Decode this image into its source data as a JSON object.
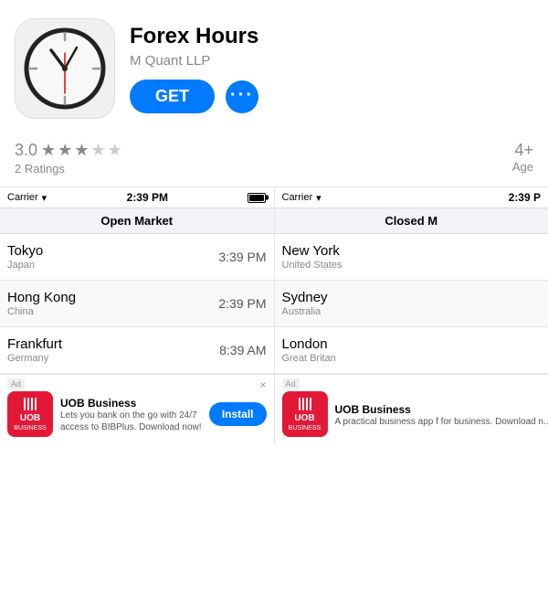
{
  "app": {
    "title": "Forex Hours",
    "developer": "M Quant LLP",
    "get_button": "GET",
    "more_dots": "···"
  },
  "rating": {
    "score": "3.0",
    "count_label": "2 Ratings",
    "age_value": "4+",
    "age_label": "Age"
  },
  "left_screenshot": {
    "carrier": "Carrier",
    "time": "2:39 PM",
    "market_status": "Open Market",
    "rows": [
      {
        "city": "Tokyo",
        "country": "Japan",
        "time": "3:39 PM"
      },
      {
        "city": "Hong Kong",
        "country": "China",
        "time": "2:39 PM"
      },
      {
        "city": "Frankfurt",
        "country": "Germany",
        "time": "8:39 AM"
      }
    ],
    "ad": {
      "label": "Ad",
      "title": "UOB Business",
      "desc": "Lets you bank on the go with 24/7 access to BIBPlus. Download now!",
      "install_label": "Install",
      "close_label": "×"
    }
  },
  "right_screenshot": {
    "carrier": "Carrier",
    "time": "2:39 P",
    "market_status": "Closed M",
    "rows": [
      {
        "city": "New York",
        "country": "United States",
        "time": ""
      },
      {
        "city": "Sydney",
        "country": "Australia",
        "time": ""
      },
      {
        "city": "London",
        "country": "Great Britan",
        "time": ""
      }
    ],
    "ad": {
      "label": "Ad",
      "title": "UOB Business",
      "desc": "A practical business app f for business. Download n..."
    }
  }
}
